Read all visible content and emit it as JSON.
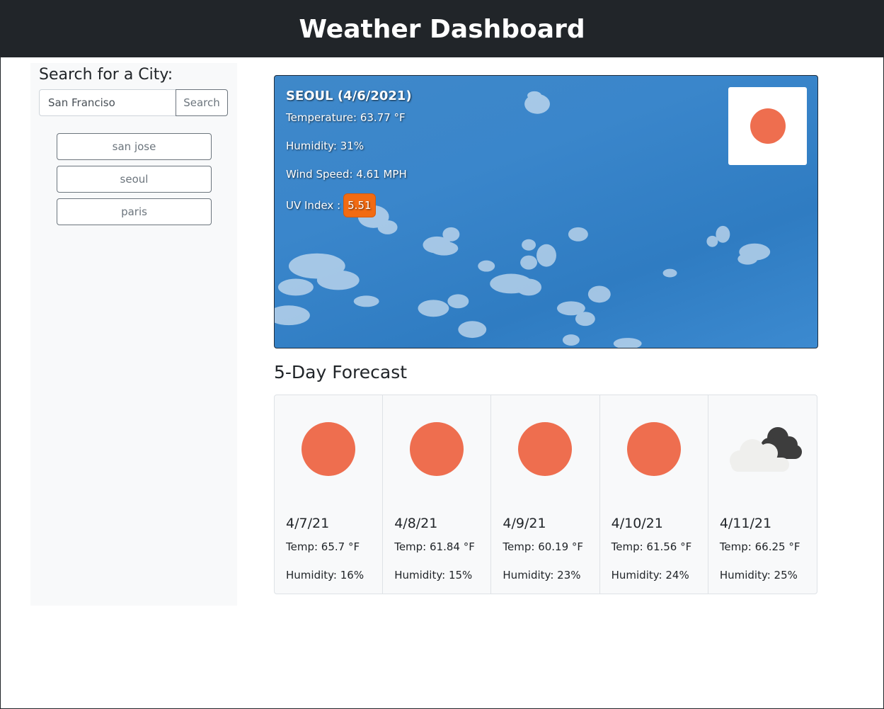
{
  "header": {
    "title": "Weather Dashboard"
  },
  "sidebar": {
    "heading": "Search for a City:",
    "search": {
      "value": "San Franciso",
      "placeholder": "",
      "button_label": "Search"
    },
    "history": [
      {
        "label": "san jose"
      },
      {
        "label": "seoul"
      },
      {
        "label": "paris"
      }
    ]
  },
  "current": {
    "title": "SEOUL (4/6/2021)",
    "temperature": "Temperature: 63.77 °F",
    "humidity": "Humidity: 31%",
    "wind": "Wind Speed: 4.61 MPH",
    "uv_label": "UV Index :",
    "uv_value": "5.51",
    "icon": "sun-icon",
    "uv_color": "#f26b12"
  },
  "forecast": {
    "title": "5-Day Forecast",
    "days": [
      {
        "date": "4/7/21",
        "temp": "Temp: 65.7 °F",
        "humidity": "Humidity: 16%",
        "icon": "sun-icon"
      },
      {
        "date": "4/8/21",
        "temp": "Temp: 61.84 °F",
        "humidity": "Humidity: 15%",
        "icon": "sun-icon"
      },
      {
        "date": "4/9/21",
        "temp": "Temp: 60.19 °F",
        "humidity": "Humidity: 23%",
        "icon": "sun-icon"
      },
      {
        "date": "4/10/21",
        "temp": "Temp: 61.56 °F",
        "humidity": "Humidity: 24%",
        "icon": "sun-icon"
      },
      {
        "date": "4/11/21",
        "temp": "Temp: 66.25 °F",
        "humidity": "Humidity: 25%",
        "icon": "cloudy-icon"
      }
    ]
  },
  "colors": {
    "header_bg": "#212529",
    "sun": "#ee6e4f",
    "sky": "#3a86cb"
  }
}
